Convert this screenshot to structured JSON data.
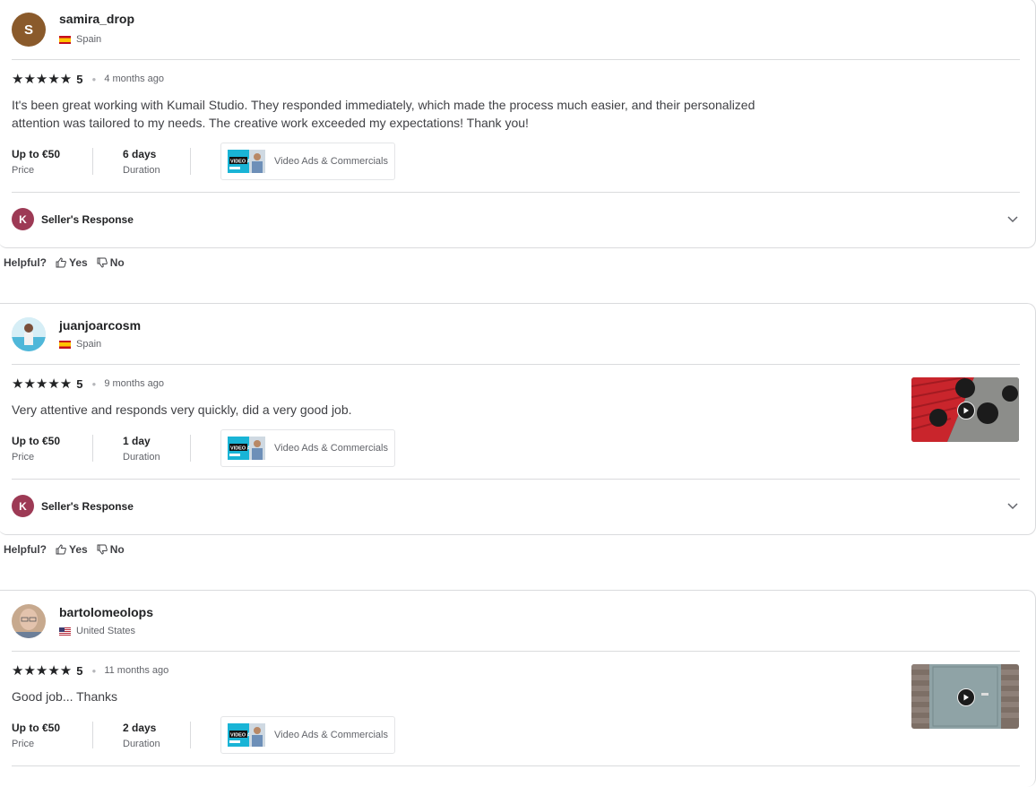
{
  "reviews": [
    {
      "username": "samira_drop",
      "avatar_letter": "S",
      "country": "Spain",
      "rating": "5",
      "time": "4 months ago",
      "text_line1": "It's been great working with Kumail Studio. They responded immediately, which made the process much easier, and their personalized",
      "text_line2": "attention was tailored to my needs. The creative work exceeded my expectations! Thank you!",
      "price": "Up to €50",
      "price_label": "Price",
      "duration": "6 days",
      "duration_label": "Duration",
      "gig": "Video Ads & Commercials",
      "seller_avatar_letter": "K",
      "seller_response": "Seller's Response",
      "helpful": "Helpful?",
      "yes": "Yes",
      "no": "No"
    },
    {
      "username": "juanjoarcosm",
      "country": "Spain",
      "rating": "5",
      "time": "9 months ago",
      "text_line1": "Very attentive and responds very quickly, did a very good job.",
      "price": "Up to €50",
      "price_label": "Price",
      "duration": "1 day",
      "duration_label": "Duration",
      "gig": "Video Ads & Commercials",
      "seller_avatar_letter": "K",
      "seller_response": "Seller's Response",
      "helpful": "Helpful?",
      "yes": "Yes",
      "no": "No"
    },
    {
      "username": "bartolomeolops",
      "country": "United States",
      "rating": "5",
      "time": "11 months ago",
      "text_line1": "Good job... Thanks",
      "price": "Up to €50",
      "price_label": "Price",
      "duration": "2 days",
      "duration_label": "Duration",
      "gig": "Video Ads & Commercials"
    }
  ],
  "gig_thumb_text": "VIDEO ADS",
  "icons": {
    "star": "star-icon",
    "thumbs_up": "thumbs-up-icon",
    "thumbs_down": "thumbs-down-icon",
    "chevron": "chevron-down-icon",
    "play": "play-icon"
  },
  "colors": {
    "star": "#222325",
    "seller_avatar": "#9d3a55",
    "user_avatar": "#8a5a2b",
    "border": "#dadbdd"
  }
}
